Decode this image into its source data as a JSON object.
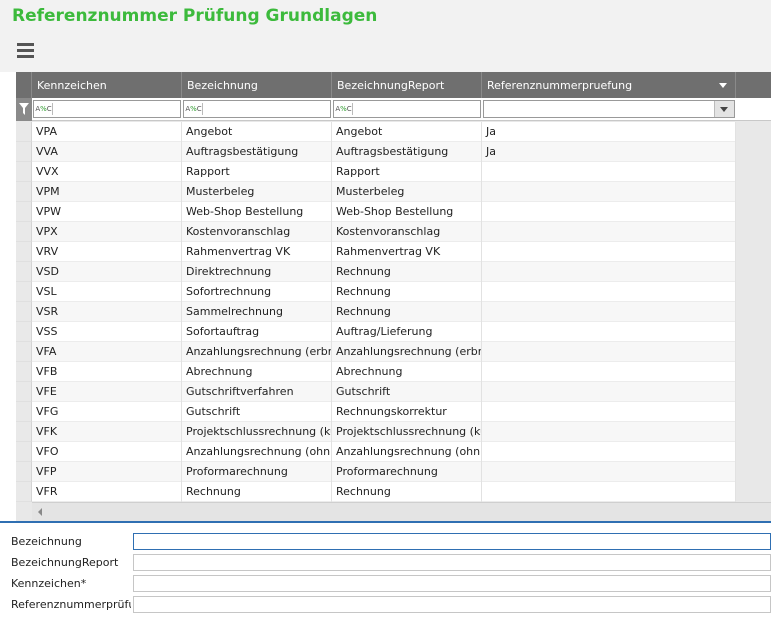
{
  "header": {
    "title": "Referenznummer Prüfung Grundlagen"
  },
  "grid": {
    "columns": [
      {
        "key": "kennzeichen",
        "label": "Kennzeichen"
      },
      {
        "key": "bezeichnung",
        "label": "Bezeichnung"
      },
      {
        "key": "bezeichnung_report",
        "label": "BezeichnungReport"
      },
      {
        "key": "referenz",
        "label": "Referenznummerpruefung"
      }
    ],
    "filter_operator": {
      "a": "A",
      "b": "%",
      "c": "C"
    },
    "rows": [
      {
        "kennzeichen": "VPA",
        "bezeichnung": "Angebot",
        "bezeichnung_report": "Angebot",
        "referenz": "Ja"
      },
      {
        "kennzeichen": "VVA",
        "bezeichnung": "Auftragsbestätigung",
        "bezeichnung_report": "Auftragsbestätigung",
        "referenz": "Ja"
      },
      {
        "kennzeichen": "VVX",
        "bezeichnung": "Rapport",
        "bezeichnung_report": "Rapport",
        "referenz": ""
      },
      {
        "kennzeichen": "VPM",
        "bezeichnung": "Musterbeleg",
        "bezeichnung_report": "Musterbeleg",
        "referenz": ""
      },
      {
        "kennzeichen": "VPW",
        "bezeichnung": "Web-Shop Bestellung",
        "bezeichnung_report": "Web-Shop Bestellung",
        "referenz": ""
      },
      {
        "kennzeichen": "VPX",
        "bezeichnung": "Kostenvoranschlag",
        "bezeichnung_report": "Kostenvoranschlag",
        "referenz": ""
      },
      {
        "kennzeichen": "VRV",
        "bezeichnung": "Rahmenvertrag VK",
        "bezeichnung_report": "Rahmenvertrag VK",
        "referenz": ""
      },
      {
        "kennzeichen": "VSD",
        "bezeichnung": "Direktrechnung",
        "bezeichnung_report": "Rechnung",
        "referenz": ""
      },
      {
        "kennzeichen": "VSL",
        "bezeichnung": "Sofortrechnung",
        "bezeichnung_report": "Rechnung",
        "referenz": ""
      },
      {
        "kennzeichen": "VSR",
        "bezeichnung": "Sammelrechnung",
        "bezeichnung_report": "Rechnung",
        "referenz": ""
      },
      {
        "kennzeichen": "VSS",
        "bezeichnung": "Sofortauftrag",
        "bezeichnung_report": "Auftrag/Lieferung",
        "referenz": ""
      },
      {
        "kennzeichen": "VFA",
        "bezeichnung": "Anzahlungsrechnung (erbr...",
        "bezeichnung_report": "Anzahlungsrechnung (erbr...",
        "referenz": ""
      },
      {
        "kennzeichen": "VFB",
        "bezeichnung": "Abrechnung",
        "bezeichnung_report": "Abrechnung",
        "referenz": ""
      },
      {
        "kennzeichen": "VFE",
        "bezeichnung": "Gutschriftverfahren",
        "bezeichnung_report": "Gutschrift",
        "referenz": ""
      },
      {
        "kennzeichen": "VFG",
        "bezeichnung": "Gutschrift",
        "bezeichnung_report": "Rechnungskorrektur",
        "referenz": ""
      },
      {
        "kennzeichen": "VFK",
        "bezeichnung": "Projektschlussrechnung (ku...",
        "bezeichnung_report": "Projektschlussrechnung (ku...",
        "referenz": ""
      },
      {
        "kennzeichen": "VFO",
        "bezeichnung": "Anzahlungsrechnung (ohn...",
        "bezeichnung_report": "Anzahlungsrechnung (ohn...",
        "referenz": ""
      },
      {
        "kennzeichen": "VFP",
        "bezeichnung": "Proformarechnung",
        "bezeichnung_report": "Proformarechnung",
        "referenz": ""
      },
      {
        "kennzeichen": "VFR",
        "bezeichnung": "Rechnung",
        "bezeichnung_report": "Rechnung",
        "referenz": ""
      }
    ]
  },
  "form": {
    "fields": [
      {
        "label": "Bezeichnung",
        "value": ""
      },
      {
        "label": "BezeichnungReport",
        "value": ""
      },
      {
        "label": "Kennzeichen*",
        "value": ""
      },
      {
        "label": "Referenznummerprüfu...",
        "value": ""
      }
    ]
  },
  "colors": {
    "title": "#3cba3c",
    "header_bg": "#6f6f6f",
    "focus": "#2f6fb2"
  },
  "icons": {
    "menu": "hamburger-icon",
    "filter": "funnel-icon",
    "dropdown": "chevron-down-icon",
    "scroll_left": "arrow-left-icon"
  }
}
